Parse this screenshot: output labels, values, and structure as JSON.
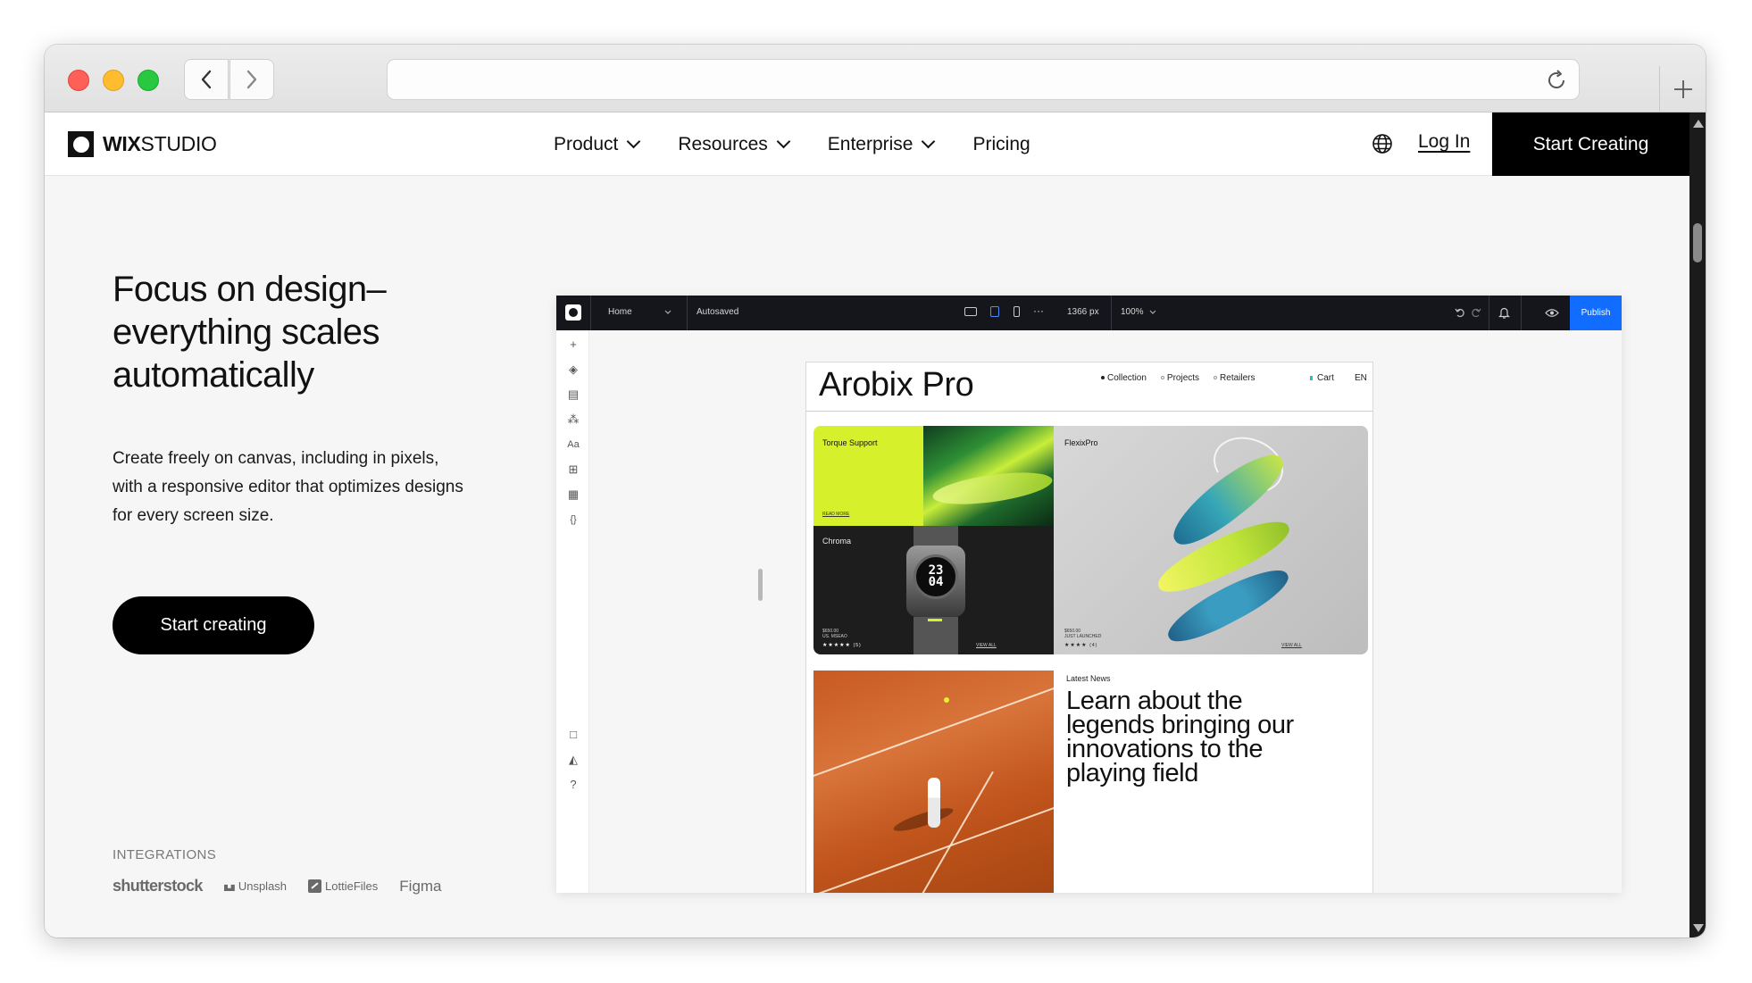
{
  "browser": {
    "url": "",
    "icons": [
      "back-chevron-icon",
      "forward-chevron-icon",
      "reload-icon",
      "plus-icon"
    ]
  },
  "header": {
    "logo_bold": "WIX",
    "logo_light": "STUDIO",
    "nav": [
      {
        "label": "Product",
        "has_dropdown": true
      },
      {
        "label": "Resources",
        "has_dropdown": true
      },
      {
        "label": "Enterprise",
        "has_dropdown": true
      },
      {
        "label": "Pricing",
        "has_dropdown": false
      }
    ],
    "login": "Log In",
    "cta": "Start Creating"
  },
  "hero": {
    "title": "Focus on design–everything scales automatically",
    "description": "Create freely on canvas, including in pixels, with a responsive editor that optimizes designs for every screen size.",
    "cta": "Start creating",
    "integrations_label": "INTEGRATIONS",
    "integrations": [
      "shutterstock",
      "Unsplash",
      "LottieFiles",
      "Figma"
    ]
  },
  "editor": {
    "page_select": "Home",
    "status": "Autosaved",
    "width": "1366 px",
    "zoom": "100%",
    "publish": "Publish",
    "accent": "#116dff",
    "site": {
      "title": "Arobix Pro",
      "nav": [
        "Collection",
        "Projects",
        "Retailers"
      ],
      "cart": "Cart",
      "lang": "EN",
      "card1_title": "Torque Support",
      "card1_link": "READ MORE",
      "card2_title": "Chroma",
      "card2_price": "$650.00",
      "card2_sub": "US. MSEAO",
      "card2_time_top": "23",
      "card2_time_bottom": "04",
      "card2_view": "VIEW ALL",
      "card3_title": "FlexixPro",
      "card3_price": "$650.00",
      "card3_sub": "JUST LAUNCHED",
      "card3_view": "VIEW ALL",
      "rating1_count": "(5)",
      "rating2_count": "(4)",
      "news_label": "Latest News",
      "news_title": "Learn about the legends bringing our innovations to the playing field"
    }
  }
}
